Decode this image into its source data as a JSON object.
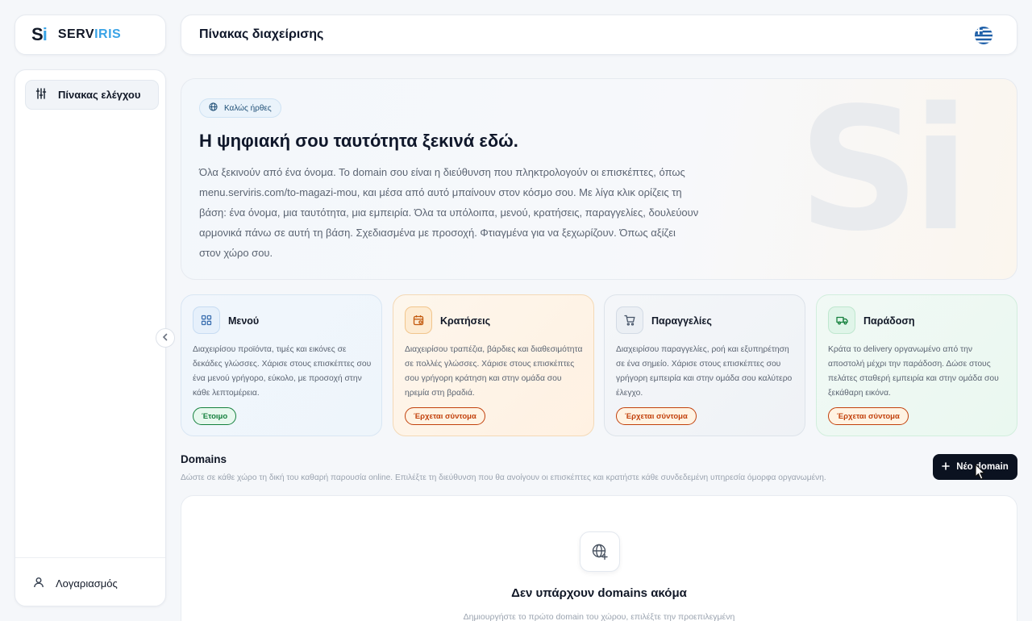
{
  "brand": {
    "mark": "Si",
    "name_part1": "SERV",
    "name_part2": "IRIS",
    "accent": "#3aa3e6"
  },
  "header": {
    "title": "Πίνακας διαχείρισης",
    "language_flag": "greece-flag-icon"
  },
  "sidebar": {
    "items": [
      {
        "label": "Πίνακας ελέγχου",
        "icon": "sliders-icon",
        "active": true
      }
    ],
    "account_label": "Λογαριασμός",
    "collapse_icon": "chevron-left-icon"
  },
  "hero": {
    "badge": "Καλώς ήρθες",
    "title": "Η ψηφιακή σου ταυτότητα ξεκινά εδώ.",
    "body": "Όλα ξεκινούν από ένα όνομα. Το domain σου είναι η διεύθυνση που πληκτρολογούν οι επισκέπτες, όπως menu.serviris.com/to-magazi-mou, και μέσα από αυτό μπαίνουν στον κόσμο σου. Με λίγα κλικ ορίζεις τη βάση: ένα όνομα, μια ταυτότητα, μια εμπειρία. Όλα τα υπόλοιπα, μενού, κρατήσεις, παραγγελίες, δουλεύουν αρμονικά πάνω σε αυτή τη βάση. Σχεδιασμένα με προσοχή. Φτιαγμένα για να ξεχωρίζουν. Όπως αξίζει στον χώρο σου.",
    "watermark": "Si"
  },
  "features": [
    {
      "title": "Μενού",
      "description": "Διαχειρίσου προϊόντα, τιμές και εικόνες σε δεκάδες γλώσσες. Χάρισε στους επισκέπτες σου ένα μενού γρήγορο, εύκολο, με προσοχή στην κάθε λεπτομέρεια.",
      "badge": "Έτοιμο",
      "icon": "grid-icon",
      "status": "ready"
    },
    {
      "title": "Κρατήσεις",
      "description": "Διαχειρίσου τραπέζια, βάρδιες και διαθεσιμότητα σε πολλές γλώσσες. Χάρισε στους επισκέπτες σου γρήγορη κράτηση και στην ομάδα σου ηρεμία στη βραδιά.",
      "badge": "Έρχεται σύντομα",
      "icon": "calendar-icon",
      "status": "soon"
    },
    {
      "title": "Παραγγελίες",
      "description": "Διαχειρίσου παραγγελίες, ροή και εξυπηρέτηση σε ένα σημείο. Χάρισε στους επισκέπτες σου γρήγορη εμπειρία και στην ομάδα σου καλύτερο έλεγχο.",
      "badge": "Έρχεται σύντομα",
      "icon": "cart-icon",
      "status": "soon"
    },
    {
      "title": "Παράδοση",
      "description": "Κράτα το delivery οργανωμένο από την αποστολή μέχρι την παράδοση. Δώσε στους πελάτες σταθερή εμπειρία και στην ομάδα σου ξεκάθαρη εικόνα.",
      "badge": "Έρχεται σύντομα",
      "icon": "truck-icon",
      "status": "soon"
    }
  ],
  "domains": {
    "title": "Domains",
    "subtitle": "Δώστε σε κάθε χώρο τη δική του καθαρή παρουσία online. Επιλέξτε τη διεύθυνση που θα ανοίγουν οι επισκέπτες και κρατήστε κάθε συνδεδεμένη υπηρεσία όμορφα οργανωμένη.",
    "new_button": "Νέο domain",
    "empty_title": "Δεν υπάρχουν domains ακόμα",
    "empty_subtitle": "Δημιουργήστε το πρώτο domain του χώρου, επιλέξτε την προεπιλεγμένη",
    "empty_icon": "globe-plus-icon"
  }
}
